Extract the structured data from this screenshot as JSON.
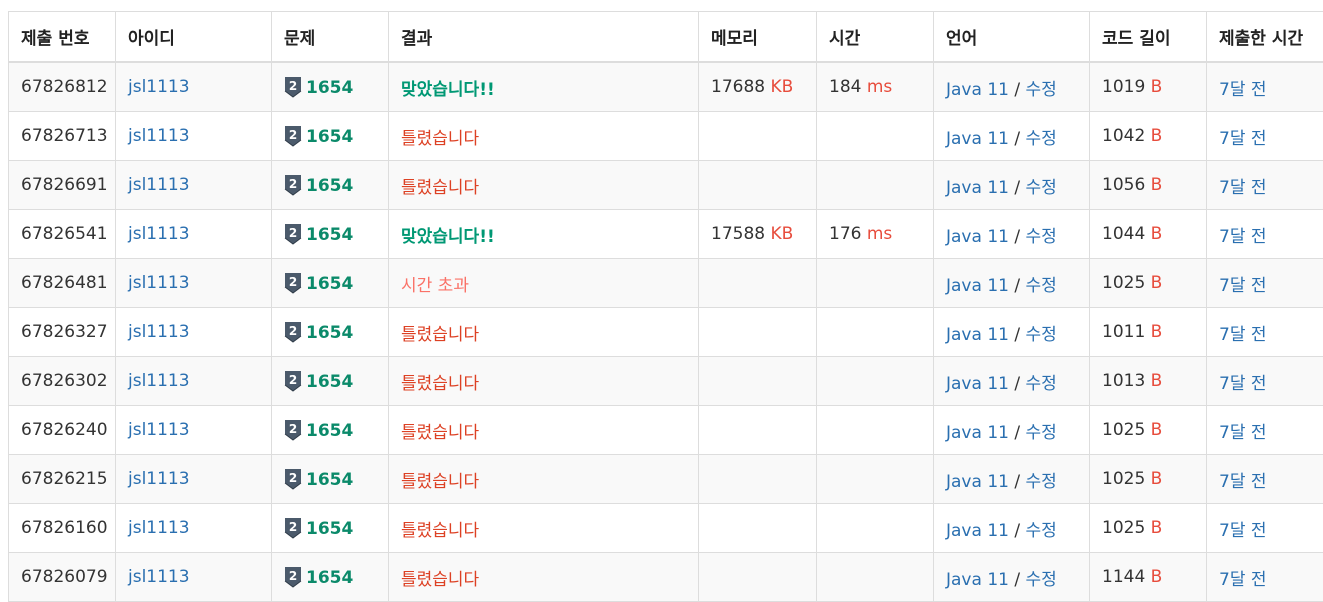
{
  "header": {
    "submission_id": "제출 번호",
    "user_id": "아이디",
    "problem": "문제",
    "result": "결과",
    "memory": "메모리",
    "time": "시간",
    "language": "언어",
    "code_length": "코드 길이",
    "submitted_at": "제출한 시간"
  },
  "colors": {
    "accepted": "#009874",
    "wrong": "#dd4124",
    "time_limit": "#fa7268",
    "link": "#2a6fb0",
    "unit": "#e74c3c",
    "tier_badge": "#4b5a6b"
  },
  "tier_icon": "silver-tier-2-icon",
  "rows": [
    {
      "id": "67826812",
      "user": "jsl1113",
      "tier": "2",
      "problem": "1654",
      "result": "맞았습니다!!",
      "result_type": "ac",
      "memory": "17688",
      "memory_unit": "KB",
      "time": "184",
      "time_unit": "ms",
      "lang": "Java 11",
      "edit": "수정",
      "sep": "/",
      "length": "1019",
      "length_unit": "B",
      "when": "7달 전"
    },
    {
      "id": "67826713",
      "user": "jsl1113",
      "tier": "2",
      "problem": "1654",
      "result": "틀렸습니다",
      "result_type": "wa",
      "memory": "",
      "memory_unit": "",
      "time": "",
      "time_unit": "",
      "lang": "Java 11",
      "edit": "수정",
      "sep": "/",
      "length": "1042",
      "length_unit": "B",
      "when": "7달 전"
    },
    {
      "id": "67826691",
      "user": "jsl1113",
      "tier": "2",
      "problem": "1654",
      "result": "틀렸습니다",
      "result_type": "wa",
      "memory": "",
      "memory_unit": "",
      "time": "",
      "time_unit": "",
      "lang": "Java 11",
      "edit": "수정",
      "sep": "/",
      "length": "1056",
      "length_unit": "B",
      "when": "7달 전"
    },
    {
      "id": "67826541",
      "user": "jsl1113",
      "tier": "2",
      "problem": "1654",
      "result": "맞았습니다!!",
      "result_type": "ac",
      "memory": "17588",
      "memory_unit": "KB",
      "time": "176",
      "time_unit": "ms",
      "lang": "Java 11",
      "edit": "수정",
      "sep": "/",
      "length": "1044",
      "length_unit": "B",
      "when": "7달 전"
    },
    {
      "id": "67826481",
      "user": "jsl1113",
      "tier": "2",
      "problem": "1654",
      "result": "시간 초과",
      "result_type": "tle",
      "memory": "",
      "memory_unit": "",
      "time": "",
      "time_unit": "",
      "lang": "Java 11",
      "edit": "수정",
      "sep": "/",
      "length": "1025",
      "length_unit": "B",
      "when": "7달 전"
    },
    {
      "id": "67826327",
      "user": "jsl1113",
      "tier": "2",
      "problem": "1654",
      "result": "틀렸습니다",
      "result_type": "wa",
      "memory": "",
      "memory_unit": "",
      "time": "",
      "time_unit": "",
      "lang": "Java 11",
      "edit": "수정",
      "sep": "/",
      "length": "1011",
      "length_unit": "B",
      "when": "7달 전"
    },
    {
      "id": "67826302",
      "user": "jsl1113",
      "tier": "2",
      "problem": "1654",
      "result": "틀렸습니다",
      "result_type": "wa",
      "memory": "",
      "memory_unit": "",
      "time": "",
      "time_unit": "",
      "lang": "Java 11",
      "edit": "수정",
      "sep": "/",
      "length": "1013",
      "length_unit": "B",
      "when": "7달 전"
    },
    {
      "id": "67826240",
      "user": "jsl1113",
      "tier": "2",
      "problem": "1654",
      "result": "틀렸습니다",
      "result_type": "wa",
      "memory": "",
      "memory_unit": "",
      "time": "",
      "time_unit": "",
      "lang": "Java 11",
      "edit": "수정",
      "sep": "/",
      "length": "1025",
      "length_unit": "B",
      "when": "7달 전"
    },
    {
      "id": "67826215",
      "user": "jsl1113",
      "tier": "2",
      "problem": "1654",
      "result": "틀렸습니다",
      "result_type": "wa",
      "memory": "",
      "memory_unit": "",
      "time": "",
      "time_unit": "",
      "lang": "Java 11",
      "edit": "수정",
      "sep": "/",
      "length": "1025",
      "length_unit": "B",
      "when": "7달 전"
    },
    {
      "id": "67826160",
      "user": "jsl1113",
      "tier": "2",
      "problem": "1654",
      "result": "틀렸습니다",
      "result_type": "wa",
      "memory": "",
      "memory_unit": "",
      "time": "",
      "time_unit": "",
      "lang": "Java 11",
      "edit": "수정",
      "sep": "/",
      "length": "1025",
      "length_unit": "B",
      "when": "7달 전"
    },
    {
      "id": "67826079",
      "user": "jsl1113",
      "tier": "2",
      "problem": "1654",
      "result": "틀렸습니다",
      "result_type": "wa",
      "memory": "",
      "memory_unit": "",
      "time": "",
      "time_unit": "",
      "lang": "Java 11",
      "edit": "수정",
      "sep": "/",
      "length": "1144",
      "length_unit": "B",
      "when": "7달 전"
    }
  ]
}
